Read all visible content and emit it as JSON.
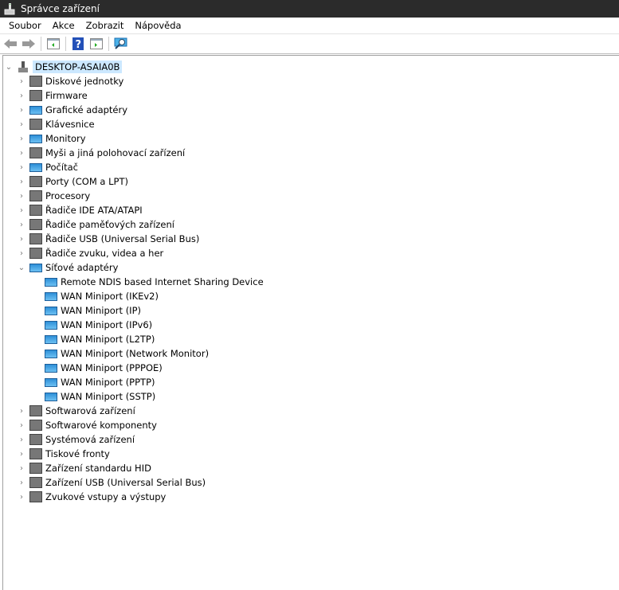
{
  "window": {
    "title": "Správce zařízení"
  },
  "menu": [
    "Soubor",
    "Akce",
    "Zobrazit",
    "Nápověda"
  ],
  "tree": {
    "root": "DESKTOP-ASAIA0B",
    "before": [
      {
        "label": "Diskové jednotky",
        "icon": "disk-icon"
      },
      {
        "label": "Firmware",
        "icon": "firmware-icon"
      },
      {
        "label": "Grafické adaptéry",
        "icon": "display-adapter-icon"
      },
      {
        "label": "Klávesnice",
        "icon": "keyboard-icon"
      },
      {
        "label": "Monitory",
        "icon": "monitor-icon"
      },
      {
        "label": "Myši a jiná polohovací zařízení",
        "icon": "mouse-icon"
      },
      {
        "label": "Počítač",
        "icon": "computer-icon"
      },
      {
        "label": "Porty (COM a LPT)",
        "icon": "port-icon"
      },
      {
        "label": "Procesory",
        "icon": "processor-icon"
      },
      {
        "label": "Řadiče IDE ATA/ATAPI",
        "icon": "ide-controller-icon"
      },
      {
        "label": "Řadiče paměťových zařízení",
        "icon": "storage-controller-icon"
      },
      {
        "label": "Řadiče USB (Universal Serial Bus)",
        "icon": "usb-icon"
      },
      {
        "label": "Řadiče zvuku, videa a her",
        "icon": "speaker-icon"
      }
    ],
    "expanded": {
      "label": "Síťové adaptéry",
      "children": [
        "Remote NDIS based Internet Sharing Device",
        "WAN Miniport (IKEv2)",
        "WAN Miniport (IP)",
        "WAN Miniport (IPv6)",
        "WAN Miniport (L2TP)",
        "WAN Miniport (Network Monitor)",
        "WAN Miniport (PPPOE)",
        "WAN Miniport (PPTP)",
        "WAN Miniport (SSTP)"
      ]
    },
    "after": [
      {
        "label": "Softwarová zařízení",
        "icon": "software-device-icon"
      },
      {
        "label": "Softwarové komponenty",
        "icon": "software-component-icon"
      },
      {
        "label": "Systémová zařízení",
        "icon": "system-device-icon"
      },
      {
        "label": "Tiskové fronty",
        "icon": "printer-icon"
      },
      {
        "label": "Zařízení standardu HID",
        "icon": "hid-icon"
      },
      {
        "label": "Zařízení USB (Universal Serial Bus)",
        "icon": "usb-icon"
      },
      {
        "label": "Zvukové vstupy a výstupy",
        "icon": "speaker-icon"
      }
    ]
  }
}
